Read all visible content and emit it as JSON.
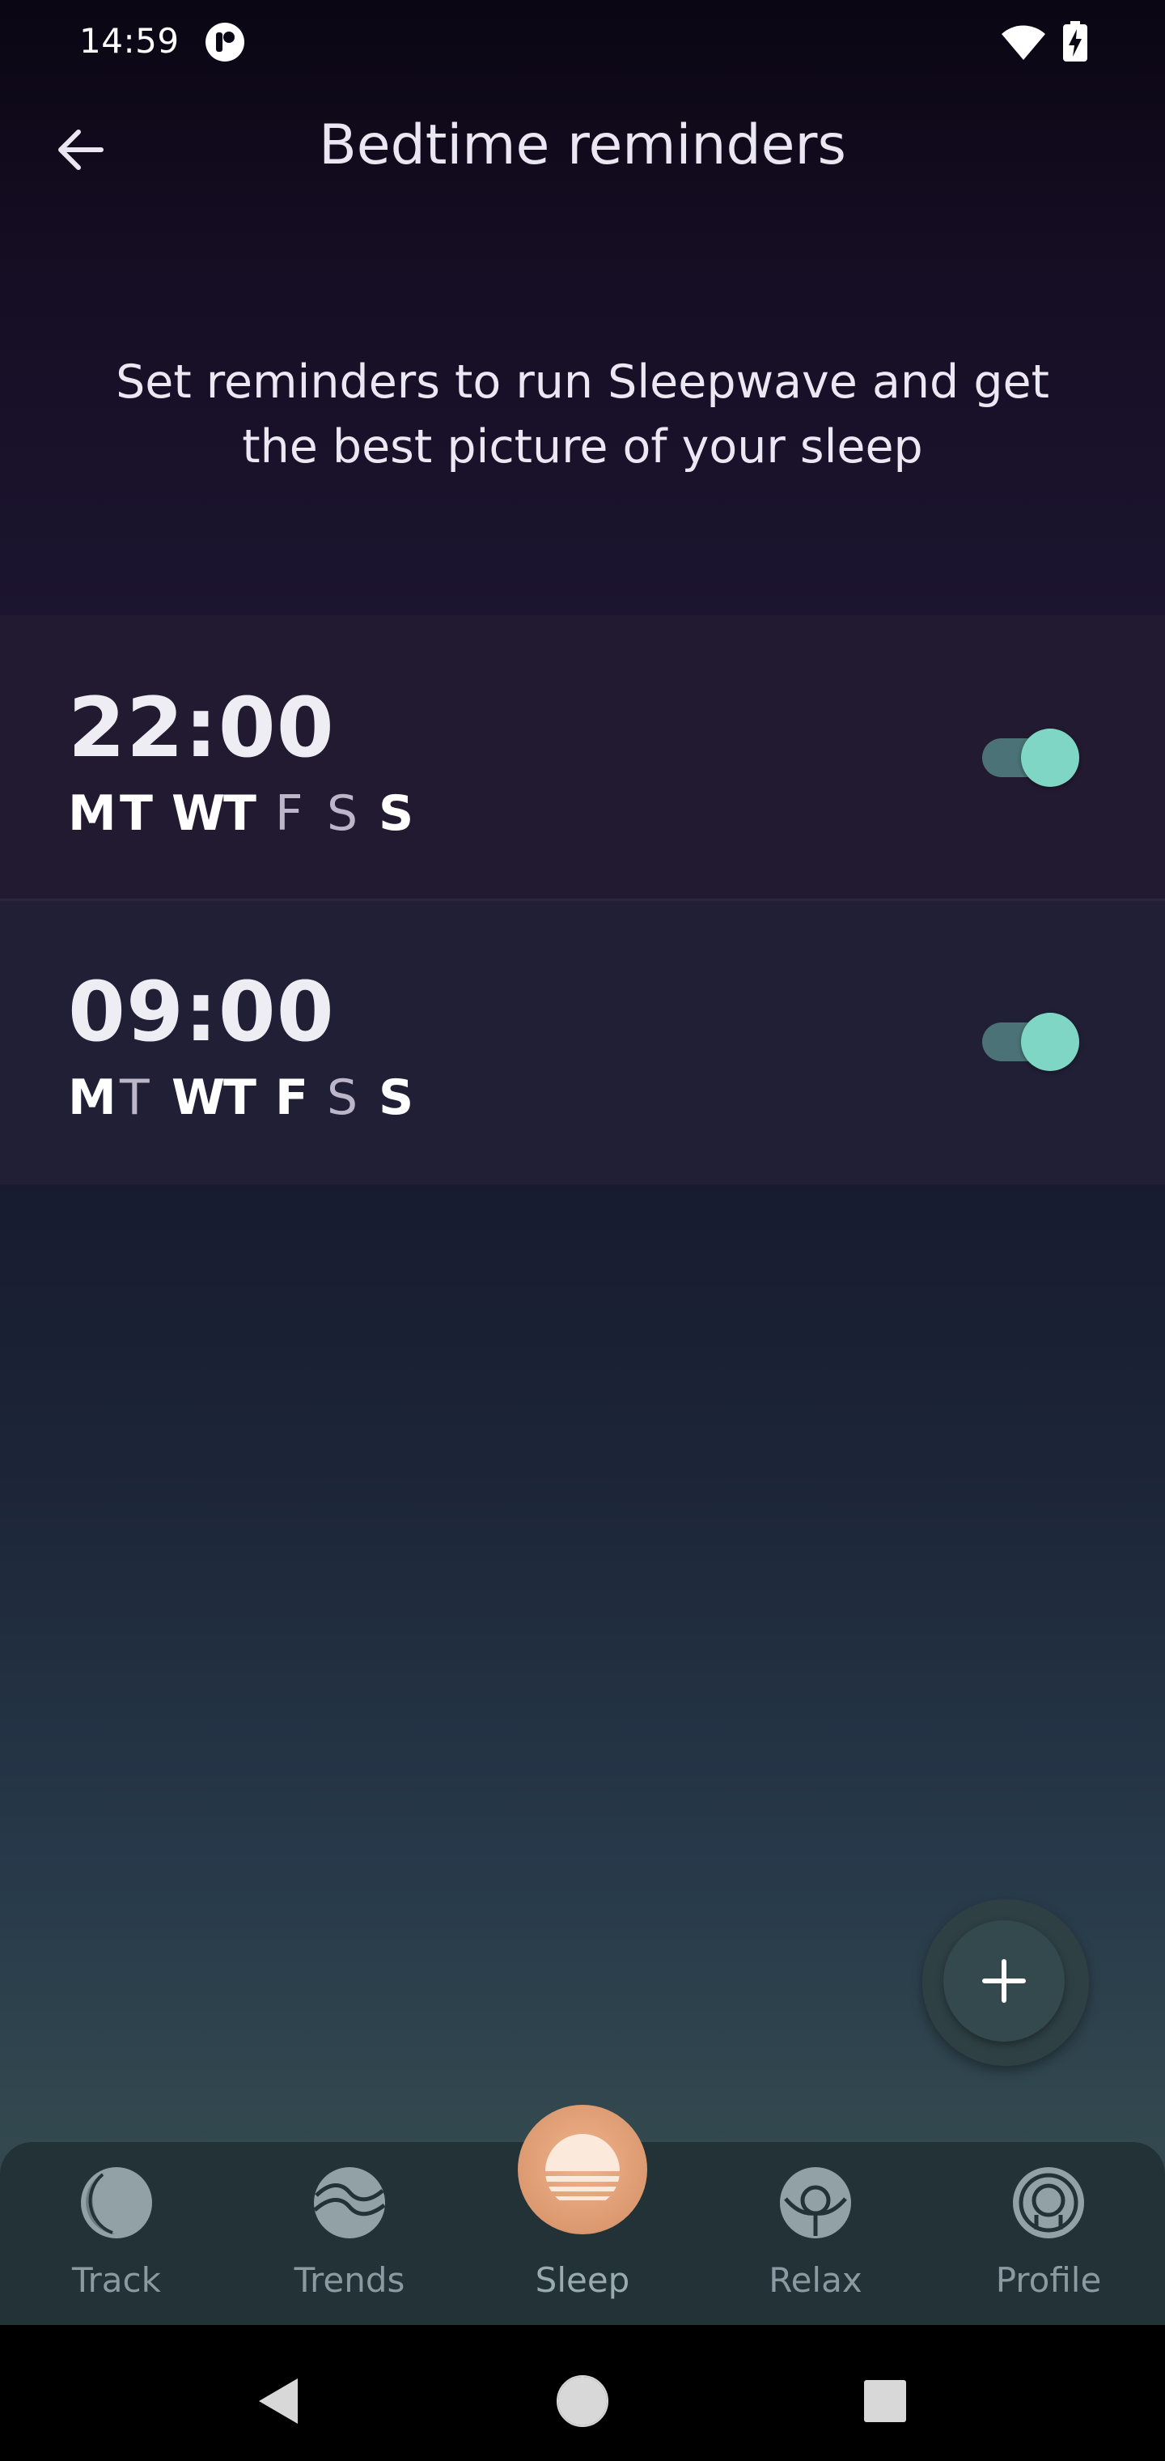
{
  "status_bar": {
    "time": "14:59"
  },
  "header": {
    "title": "Bedtime reminders"
  },
  "intro": {
    "line1": "Set reminders to run Sleepwave and get",
    "line2": "the best picture of your sleep"
  },
  "reminders": [
    {
      "time": "22:00",
      "enabled": true,
      "days": [
        {
          "letter": "M",
          "active": true
        },
        {
          "letter": "T",
          "active": true
        },
        {
          "letter": "W",
          "active": true
        },
        {
          "letter": "T",
          "active": true
        },
        {
          "letter": "F",
          "active": false
        },
        {
          "letter": "S",
          "active": false
        },
        {
          "letter": "S",
          "active": true
        }
      ]
    },
    {
      "time": "09:00",
      "enabled": true,
      "days": [
        {
          "letter": "M",
          "active": true
        },
        {
          "letter": "T",
          "active": false
        },
        {
          "letter": "W",
          "active": true
        },
        {
          "letter": "T",
          "active": true
        },
        {
          "letter": "F",
          "active": true
        },
        {
          "letter": "S",
          "active": false
        },
        {
          "letter": "S",
          "active": true
        }
      ]
    }
  ],
  "fab": {
    "icon": "plus-icon"
  },
  "nav": {
    "items": [
      {
        "label": "Track",
        "icon": "moon-icon"
      },
      {
        "label": "Trends",
        "icon": "waves-icon"
      },
      {
        "label": "Sleep",
        "icon": "sunset-icon"
      },
      {
        "label": "Relax",
        "icon": "lotus-icon"
      },
      {
        "label": "Profile",
        "icon": "profile-icon"
      }
    ]
  },
  "colors": {
    "accent": "#7fd6c5",
    "sleep_button": "#e8a47c",
    "nav_bg": "#223237"
  }
}
